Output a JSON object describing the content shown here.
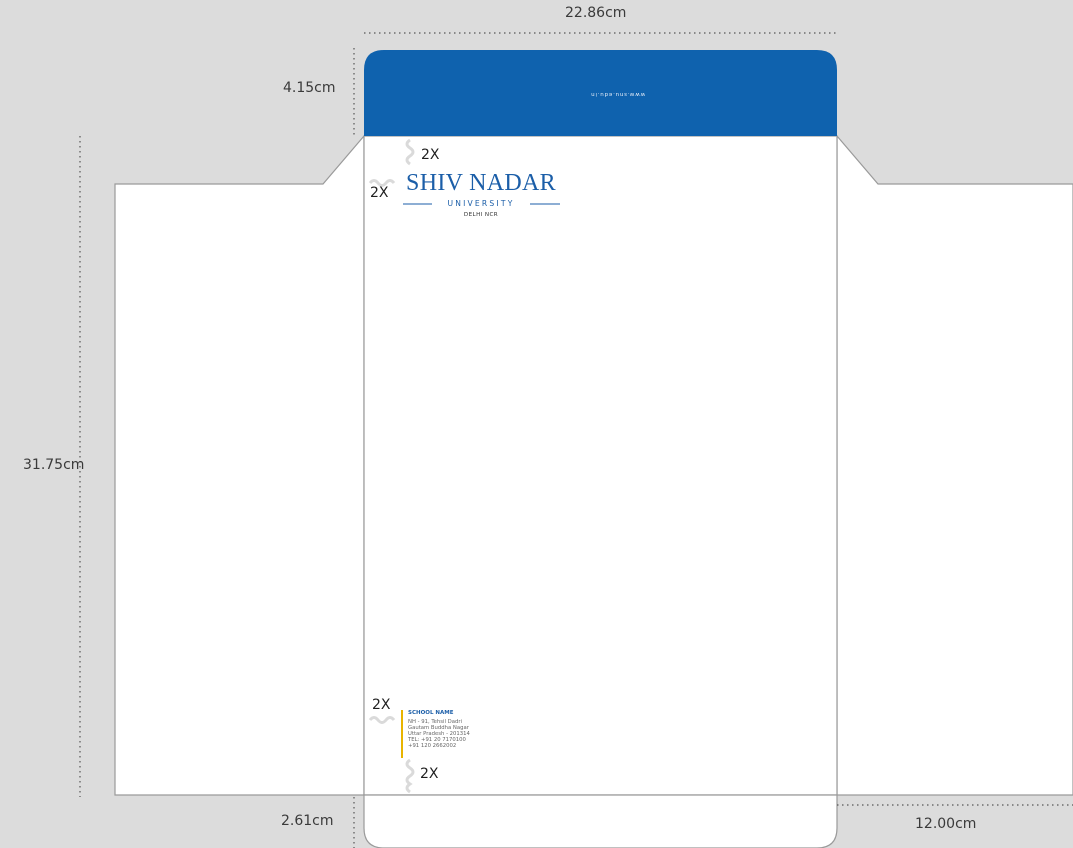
{
  "dimensions": {
    "width": "22.86cm",
    "flap_height": "4.15cm",
    "total_height": "31.75cm",
    "bottom_flap": "2.61cm",
    "side_flap": "12.00cm"
  },
  "spacing_markers": [
    "2X",
    "2X",
    "2X",
    "2X"
  ],
  "logo": {
    "name": "SHIV NADAR",
    "subtitle": "UNIVERSITY",
    "location": "DELHI NCR"
  },
  "flap_text": "www.snu.edu.in",
  "address": {
    "school": "SCHOOL NAME",
    "lines": [
      "NH - 91, Tehsil Dadri",
      "Gautam Buddha Nagar",
      "Uttar Pradesh - 201314",
      "TEL: +91 20 7170100",
      "+91 120 2662002"
    ]
  },
  "colors": {
    "brand_blue": "#0f62ae",
    "accent_yellow": "#e8b400",
    "background": "#dcdcdc"
  }
}
